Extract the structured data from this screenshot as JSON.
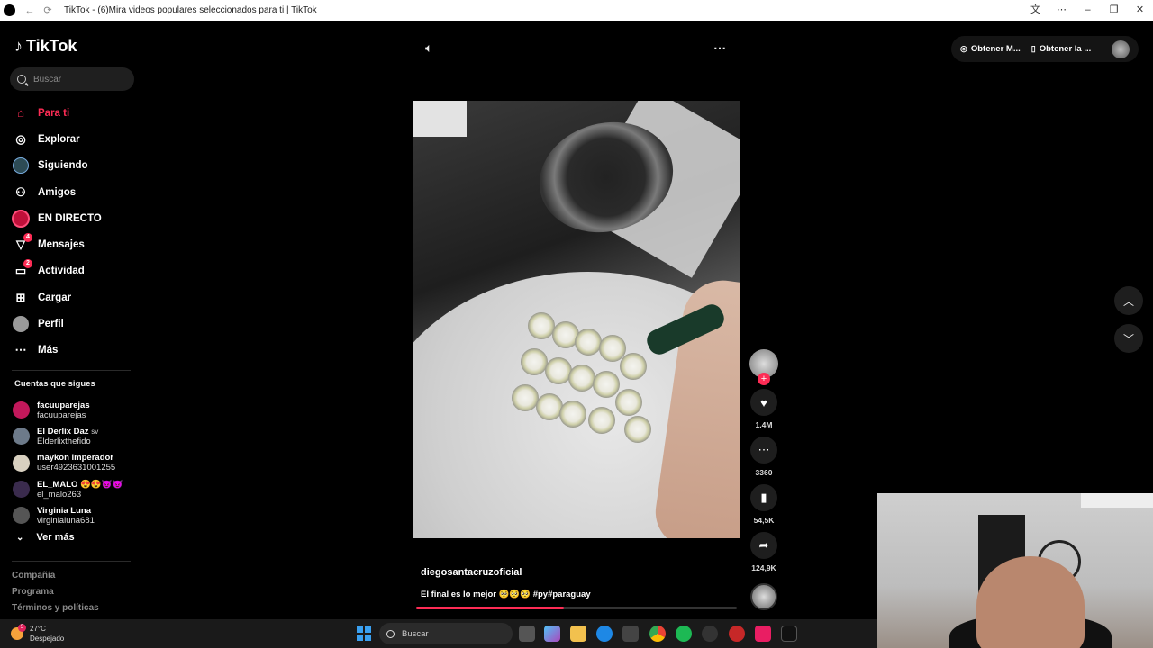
{
  "window": {
    "title": "TikTok - (6)Mira videos populares seleccionados para ti | TikTok"
  },
  "sidebar": {
    "logo": "TikTok",
    "search_placeholder": "Buscar",
    "items": [
      {
        "label": "Para ti",
        "icon": "home-icon",
        "active": true
      },
      {
        "label": "Explorar",
        "icon": "compass-icon"
      },
      {
        "label": "Siguiendo",
        "icon": "following-icon"
      },
      {
        "label": "Amigos",
        "icon": "friends-icon"
      },
      {
        "label": "EN DIRECTO",
        "icon": "live-icon"
      },
      {
        "label": "Mensajes",
        "icon": "messages-icon",
        "badge": "4"
      },
      {
        "label": "Actividad",
        "icon": "activity-icon",
        "badge": "2"
      },
      {
        "label": "Cargar",
        "icon": "upload-icon"
      },
      {
        "label": "Perfil",
        "icon": "profile-icon"
      },
      {
        "label": "Más",
        "icon": "more-icon"
      }
    ],
    "following_title": "Cuentas que sigues",
    "following": [
      {
        "name": "facuuparejas",
        "handle": "facuuparejas",
        "color": "#c2185b"
      },
      {
        "name": "El Derlix Daz",
        "suffix": "sv",
        "handle": "Elderlixthefido",
        "color": "#6d7a8a"
      },
      {
        "name": "maykon imperador",
        "handle": "user4923631001255",
        "color": "#d8d0c0"
      },
      {
        "name": "EL_MALO 😍😍😈😈",
        "handle": "el_malo263",
        "color": "#3a2b4d"
      },
      {
        "name": "Virginia Luna",
        "handle": "virginialuna681",
        "color": "#555555"
      }
    ],
    "see_more": "Ver más",
    "footer": [
      "Compañía",
      "Programa",
      "Términos y políticas"
    ]
  },
  "player": {
    "volume_icon": "volume-icon",
    "more_icon": "more-options-icon",
    "author": "diegosantacruzoficial",
    "caption": "El final es lo mejor 🥺🥺🥺 #py#paraguay",
    "progress": 0.46,
    "actions": [
      {
        "name": "like",
        "icon": "heart-icon",
        "count": "1.4M"
      },
      {
        "name": "comment",
        "icon": "comment-icon",
        "count": "3360"
      },
      {
        "name": "save",
        "icon": "bookmark-icon",
        "count": "54,5K"
      },
      {
        "name": "share",
        "icon": "share-icon",
        "count": "124,9K"
      }
    ]
  },
  "topbar": {
    "coins_label": "Obtener M...",
    "app_label": "Obtener la ..."
  },
  "taskbar": {
    "temp": "27°C",
    "weather": "Despejado",
    "weather_badge": "5",
    "search": "Buscar"
  },
  "colors": {
    "accent": "#fe2c55",
    "background": "#000000",
    "surface": "#1e1e1e"
  }
}
